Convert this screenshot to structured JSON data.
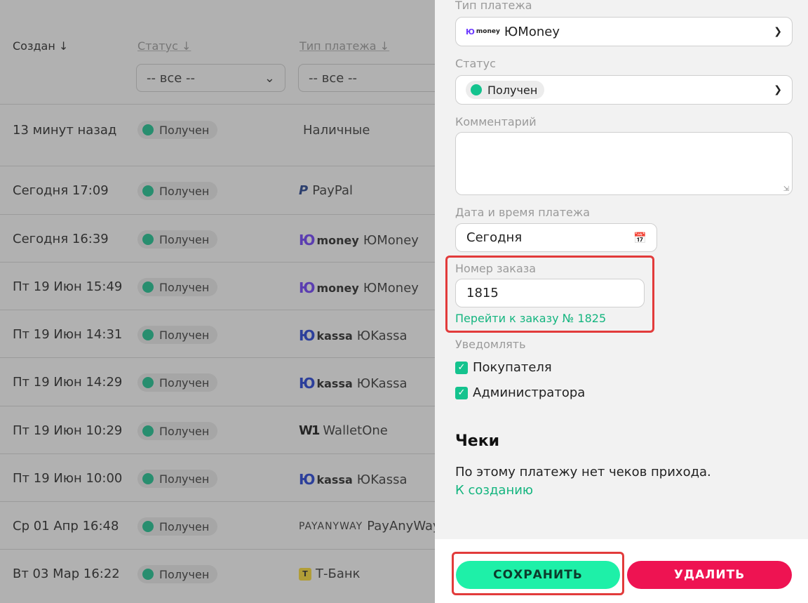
{
  "table": {
    "headers": {
      "created": "Создан ↓",
      "status": "Статус ↓",
      "payment_type": "Тип платежа ↓"
    },
    "filters": {
      "status_value": "-- все --",
      "type_value": "-- все --"
    },
    "rows": [
      {
        "date": "13 минут назад",
        "status": "Получен",
        "type": "Наличные",
        "logo": ""
      },
      {
        "date": "Сегодня 17:09",
        "status": "Получен",
        "type": "PayPal",
        "logo": "P"
      },
      {
        "date": "Сегодня 16:39",
        "status": "Получен",
        "type": "ЮMoney",
        "logo": "money"
      },
      {
        "date": "Пт 19 Июн 15:49",
        "status": "Получен",
        "type": "ЮMoney",
        "logo": "money"
      },
      {
        "date": "Пт 19 Июн 14:31",
        "status": "Получен",
        "type": "ЮKassa",
        "logo": "kassa"
      },
      {
        "date": "Пт 19 Июн 14:29",
        "status": "Получен",
        "type": "ЮKassa",
        "logo": "kassa"
      },
      {
        "date": "Пт 19 Июн 10:29",
        "status": "Получен",
        "type": "WalletOne",
        "logo": "W1"
      },
      {
        "date": "Пт 19 Июн 10:00",
        "status": "Получен",
        "type": "ЮKassa",
        "logo": "kassa"
      },
      {
        "date": "Ср 01 Апр 16:48",
        "status": "Получен",
        "type": "PayAnyWay",
        "logo": "PAYANYWAY"
      },
      {
        "date": "Вт 03 Мар 16:22",
        "status": "Получен",
        "type": "Т-Банк",
        "logo": "T"
      }
    ]
  },
  "panel": {
    "payment_type_label": "Тип платежа",
    "payment_type_value": "ЮMoney",
    "payment_type_logo": "money",
    "status_label": "Статус",
    "status_value": "Получен",
    "comment_label": "Комментарий",
    "comment_value": "",
    "datetime_label": "Дата и время платежа",
    "datetime_value": "Сегодня",
    "order_label": "Номер заказа",
    "order_value": "1815",
    "order_link": "Перейти к заказу № 1825",
    "notify_label": "Уведомлять",
    "notify_buyer": "Покупателя",
    "notify_admin": "Администратора",
    "receipts_title": "Чеки",
    "receipts_text": "По этому платежу нет чеков прихода.",
    "receipts_link": "К созданию",
    "save_label": "СОХРАНИТЬ",
    "delete_label": "УДАЛИТЬ"
  },
  "colors": {
    "accent": "#14c38e",
    "save_bg": "#1ef0a8",
    "delete_bg": "#ee1352",
    "highlight": "#e23b3b"
  }
}
